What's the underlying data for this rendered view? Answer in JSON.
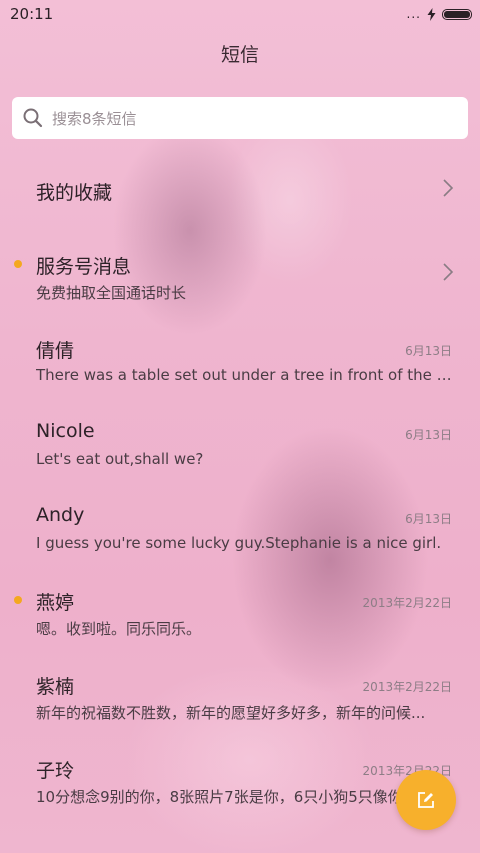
{
  "status_bar": {
    "time": "20:11",
    "signal_dots": "...",
    "icons": [
      "notification-dots-icon",
      "charging-bolt-icon",
      "battery-icon"
    ]
  },
  "header": {
    "title": "短信"
  },
  "search": {
    "placeholder": "搜索8条短信"
  },
  "conversations": [
    {
      "name": "我的收藏",
      "preview": "",
      "date": "",
      "unread": false,
      "chevron": true
    },
    {
      "name": "服务号消息",
      "preview": "免费抽取全国通话时长",
      "date": "",
      "unread": true,
      "chevron": true
    },
    {
      "name": "倩倩",
      "preview": "There was a table set out under a tree in front of the ho...",
      "date": "6月13日",
      "unread": false,
      "chevron": false
    },
    {
      "name": "Nicole",
      "preview": "Let's eat out,shall we?",
      "date": "6月13日",
      "unread": false,
      "chevron": false
    },
    {
      "name": "Andy",
      "preview": "I guess you're some lucky guy.Stephanie is a nice girl.",
      "date": "6月13日",
      "unread": false,
      "chevron": false
    },
    {
      "name": "燕婷",
      "preview": "嗯。收到啦。同乐同乐。",
      "date": "2013年2月22日",
      "unread": true,
      "chevron": false
    },
    {
      "name": "紫楠",
      "preview": "新年的祝福数不胜数，新年的愿望好多好多，新年的问候...",
      "date": "2013年2月22日",
      "unread": false,
      "chevron": false
    },
    {
      "name": "子玲",
      "preview": "10分想念9别的你，8张照片7张是你，6只小狗5只像你",
      "date": "2013年2月22日",
      "unread": false,
      "chevron": false
    }
  ],
  "fab": {
    "icon": "compose-icon",
    "color": "#f7b02c"
  },
  "colors": {
    "unread_dot": "#f4a81f",
    "background": "#f0b6cf"
  }
}
